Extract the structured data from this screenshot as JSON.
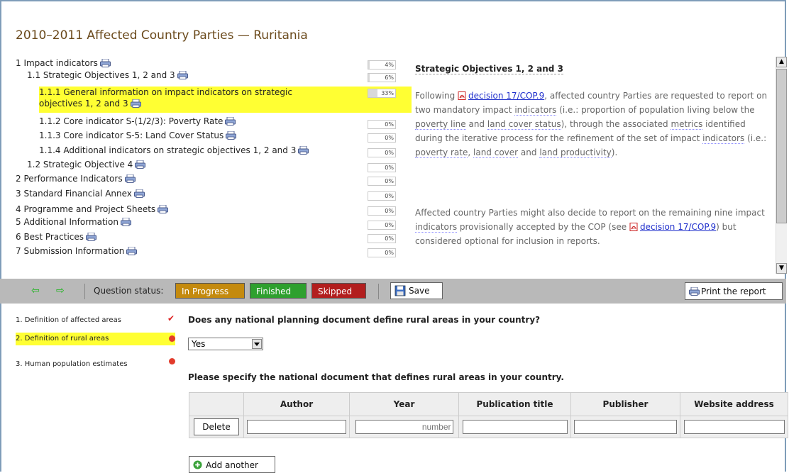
{
  "title": "2010–2011 Affected Country Parties — Ruritania",
  "tree": [
    {
      "label": "1 Impact indicators",
      "progress": 4,
      "progress_label": "4%"
    },
    {
      "label": "1.1 Strategic Objectives 1, 2 and 3",
      "progress": 6,
      "progress_label": "6%"
    },
    {
      "label": "1.1.1 General information on impact indicators on strategic",
      "label2": "objectives 1, 2 and 3",
      "progress": 33,
      "progress_label": "33%"
    },
    {
      "label": "1.1.2 Core indicator S-(1/2/3): Poverty Rate",
      "progress": 0,
      "progress_label": "0%"
    },
    {
      "label": "1.1.3 Core indicator S-5: Land Cover Status",
      "progress": 0,
      "progress_label": "0%"
    },
    {
      "label": "1.1.4 Additional indicators on strategic objectives 1, 2 and 3",
      "progress": 0,
      "progress_label": "0%"
    },
    {
      "label": "1.2 Strategic Objective 4",
      "progress": 0,
      "progress_label": "0%"
    },
    {
      "label": "2 Performance Indicators",
      "progress": 0,
      "progress_label": "0%"
    },
    {
      "label": "3 Standard Financial Annex",
      "progress": 0,
      "progress_label": "0%"
    },
    {
      "label": "4 Programme and Project Sheets",
      "progress": 0,
      "progress_label": "0%"
    },
    {
      "label": "5 Additional Information",
      "progress": 0,
      "progress_label": "0%"
    },
    {
      "label": "6 Best Practices",
      "progress": 0,
      "progress_label": "0%"
    },
    {
      "label": "7 Submission Information",
      "progress": 0,
      "progress_label": "0%"
    }
  ],
  "description": {
    "heading": "Strategic Objectives 1, 2 and 3",
    "p1_a": "Following ",
    "p1_link": "decision 17/COP.9",
    "p1_b": ", affected country Parties are requested to report on two mandatory impact ",
    "p1_w1": "indicators",
    "p1_c": " (i.e.: proportion of population living below the ",
    "p1_w2": "poverty line",
    "p1_d": " and ",
    "p1_w3": "land cover status",
    "p1_e": "), through the associated ",
    "p1_w4": "metrics",
    "p1_f": " identified during the iterative process for the refinement of the set of impact ",
    "p1_w5": "indicators",
    "p1_g": " (i.e.: ",
    "p1_w6": "poverty rate",
    "p1_h": ", ",
    "p1_w7": "land cover",
    "p1_i": " and ",
    "p1_w8": "land productivity",
    "p1_j": ").",
    "p2_a": "Affected country Parties might also decide to report on the remaining nine impact ",
    "p2_w1": "indicators",
    "p2_b": " provisionally accepted by the COP (see ",
    "p2_link": "decision 17/COP.9",
    "p2_c": ") but considered optional for inclusion in reports."
  },
  "toolbar": {
    "question_status_label": "Question status:",
    "in_progress": "In Progress",
    "finished": "Finished",
    "skipped": "Skipped",
    "save": "Save",
    "print": "Print the report",
    "colors": {
      "in_progress": "#c48a0e",
      "finished": "#2ea02e",
      "skipped": "#b21e1e",
      "arrows": "#1db31d",
      "highlight": "#ffff33"
    }
  },
  "questions_nav": [
    {
      "label": "1.  Definition of affected areas",
      "status": "done"
    },
    {
      "label": "2.  Definition of rural areas",
      "status": "pending"
    },
    {
      "label": "3.  Human population estimates",
      "status": "pending"
    }
  ],
  "question1": "Does any national planning document define rural areas in your country?",
  "select_value": "Yes",
  "question2": "Please specify the national document that defines rural areas in your country.",
  "table": {
    "headers": [
      "",
      "Author",
      "Year",
      "Publication title",
      "Publisher",
      "Website address"
    ],
    "delete_label": "Delete",
    "year_placeholder": "number"
  },
  "add_another": "Add another"
}
